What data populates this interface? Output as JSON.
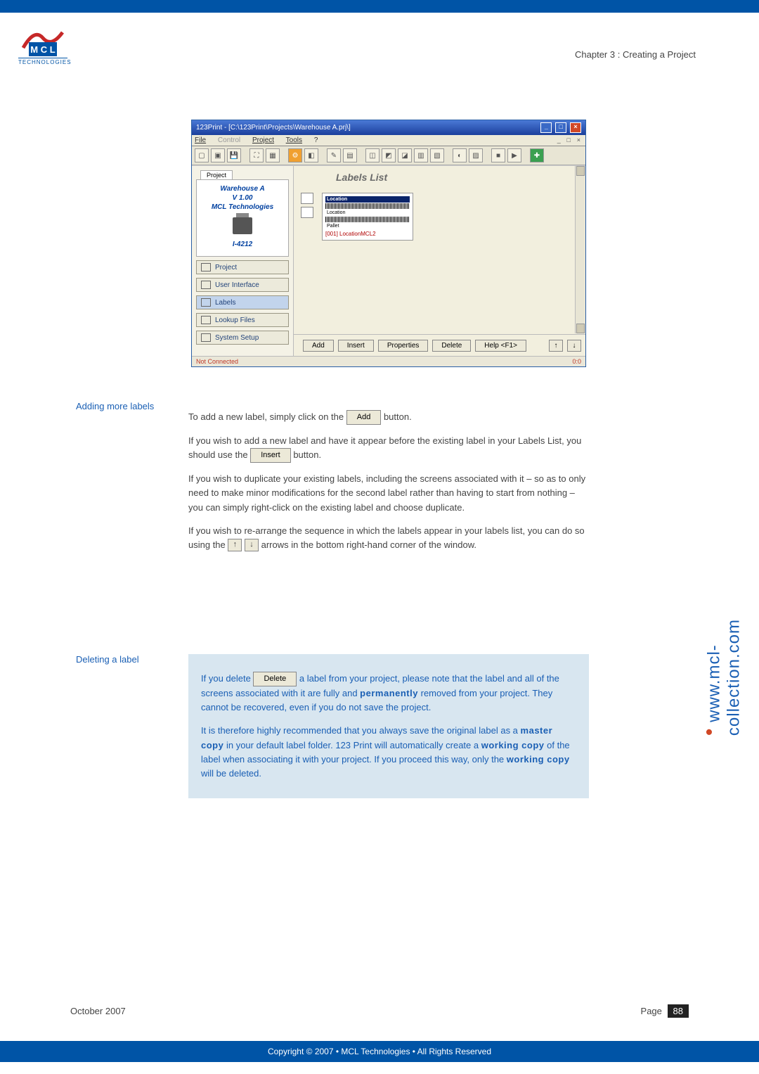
{
  "header": {
    "chapter": "Chapter 3 : Creating a Project"
  },
  "logo": {
    "tech": "TECHNOLOGIES"
  },
  "screenshot": {
    "title": "123Print - [C:\\123Print\\Projects\\Warehouse A.prj\\]",
    "menu": {
      "file": "File",
      "control": "Control",
      "project": "Project",
      "tools": "Tools",
      "help": "?"
    },
    "restore": {
      "min": "_",
      "max": "□",
      "close": "×"
    },
    "win": {
      "min": "_",
      "max": "□",
      "close": "×"
    },
    "side": {
      "tab": "Project",
      "name": "Warehouse A",
      "version": "V 1.00",
      "company": "MCL Technologies",
      "printer": "I-4212",
      "buttons": {
        "project": "Project",
        "ui": "User Interface",
        "labels": "Labels",
        "lookup": "Lookup Files",
        "system": "System Setup"
      }
    },
    "main": {
      "header": "Labels List",
      "label_rows": {
        "r1": "Location",
        "r2": "Location",
        "r3": "Pallet"
      },
      "selected": "[001] LocationMCL2"
    },
    "actions": {
      "add": "Add",
      "insert": "Insert",
      "properties": "Properties",
      "delete": "Delete",
      "help": "Help <F1>",
      "up": "↑",
      "down": "↓"
    },
    "status": {
      "left": "Not Connected",
      "right": "0:0"
    }
  },
  "doc": {
    "adding_heading": "Adding more labels",
    "adding_p1a": "To add a new label, simply click on the ",
    "btn_add": "Add",
    "adding_p1b": " button.",
    "adding_p2a": "If you wish to add a new label and have it appear before the existing label in your Labels List, you should use the ",
    "btn_insert": "Insert",
    "adding_p2b": " button.",
    "adding_p3": "If you wish to duplicate your existing labels, including the screens associated with it – so as to only need to make minor modifications for the second label rather than having to start from nothing – you can simply right-click on the existing label and choose duplicate.",
    "adding_p4a": "If you wish to re-arrange the sequence in which the labels appear in your labels list, you can do so using the ",
    "arrow_up": "↑",
    "arrow_down": "↓",
    "adding_p4b": " arrows in the bottom right-hand corner of the window.",
    "deleting_heading": "Deleting a label",
    "deleting_p1a": "If you delete ",
    "btn_delete": "Delete",
    "deleting_p1b": "a label from your project, please note that the label and all of the screens associated with it are fully and ",
    "deleting_p1c": "permanently",
    "deleting_p1d": " removed from your project. They cannot be recovered, even if you do not save the project.",
    "deleting_p2a": "It is therefore highly recommended that you always save the original label as a ",
    "deleting_p2b": "master copy",
    "deleting_p2c": " in your default label folder. 123 Print will automatically create a ",
    "deleting_p2d": "working copy",
    "deleting_p2e": " of the label when associating it with your project. If you proceed this way, only the ",
    "deleting_p2f": "working copy",
    "deleting_p2g": " will be deleted."
  },
  "side_url": {
    "dot": "•",
    "text": "www.mcl-collection.com"
  },
  "footer": {
    "date": "October 2007",
    "page_label": "Page",
    "page_num": "88"
  },
  "copyright": "Copyright © 2007 • MCL Technologies • All Rights Reserved"
}
